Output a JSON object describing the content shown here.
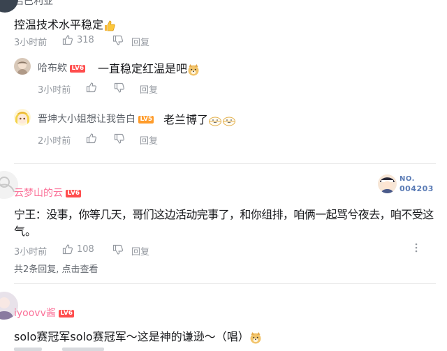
{
  "partial_top": {
    "text": "吕巴利亚"
  },
  "comment1": {
    "text": "控温技术水平稳定",
    "time": "3小时前",
    "likes": "318",
    "reply": "回复",
    "replies": [
      {
        "user": "哈布欸",
        "level": "LV6",
        "text": "一直稳定红温是吧",
        "time": "3小时前",
        "reply": "回复"
      },
      {
        "user": "晋坤大小姐想让我告白",
        "level": "LV5",
        "text": "老兰博了",
        "time": "2小时前",
        "reply": "回复"
      }
    ]
  },
  "comment2": {
    "user": "云梦山的云",
    "level": "LV6",
    "badge_no": "NO.",
    "badge_num": "004203",
    "text_line1": "宁王：没事，你等几天，哥们这边活动完事了，和你组排，咱俩一起骂兮夜去，咱不受这",
    "text_line2": "气。",
    "time": "3小时前",
    "likes": "108",
    "reply": "回复",
    "sub_replies": "共2条回复, 点击查看"
  },
  "comment3": {
    "user": "iyoovv酱",
    "level": "LV6",
    "text": "solo赛冠军solo赛冠军～这是神的谦逊～（唱）"
  },
  "colors": {
    "username_pink": "#fb7299",
    "meta_gray": "#9499a0",
    "lv6": "#ff4d4d",
    "lv5": "#ff9c2b"
  }
}
